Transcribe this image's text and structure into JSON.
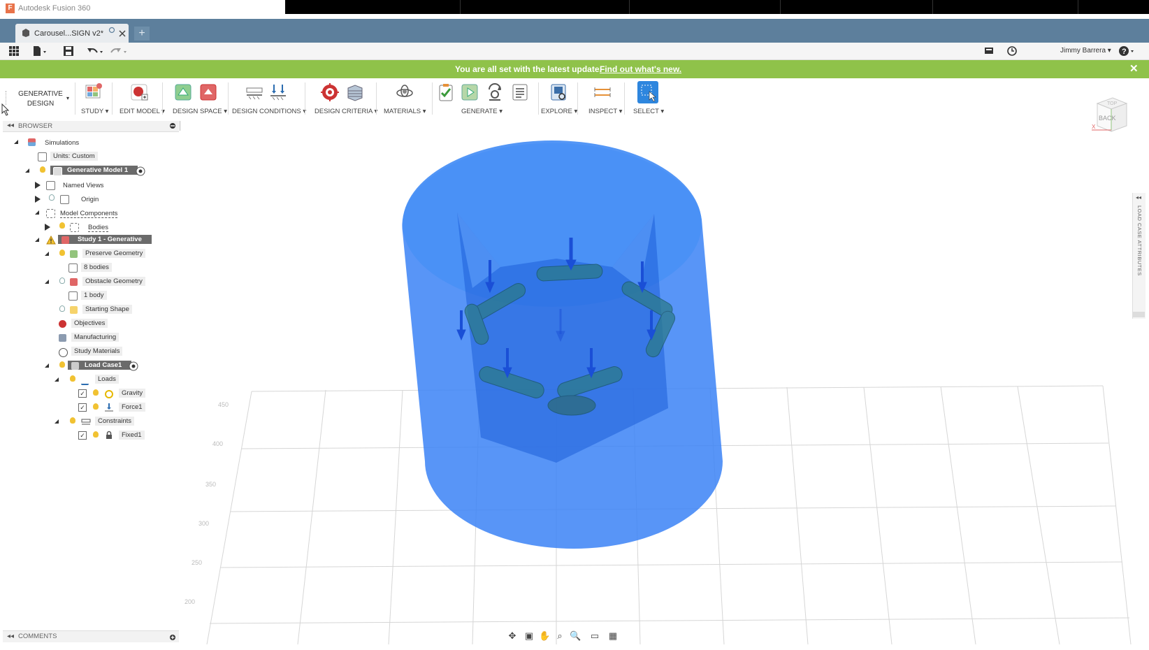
{
  "window": {
    "app_title": "Autodesk Fusion 360",
    "logo_glyph": "F"
  },
  "tabs": [
    {
      "label": "Carousel...SIGN v2*"
    }
  ],
  "quick_access": {
    "new_tab": "+",
    "user_name": "Jimmy Barrera ▾"
  },
  "banner": {
    "text": "You are all set with the latest update.",
    "link": "Find out what's new.",
    "close": "✕"
  },
  "toolbar": {
    "workspace": {
      "line1": "GENERATIVE",
      "line2": "DESIGN"
    },
    "groups": [
      {
        "label": "STUDY ▾"
      },
      {
        "label": "EDIT MODEL ▾"
      },
      {
        "label": "DESIGN SPACE ▾"
      },
      {
        "label": "DESIGN CONDITIONS ▾"
      },
      {
        "label": "DESIGN CRITERIA ▾"
      },
      {
        "label": "MATERIALS ▾"
      },
      {
        "label": "GENERATE ▾"
      },
      {
        "label": "EXPLORE ▾"
      },
      {
        "label": "INSPECT ▾"
      },
      {
        "label": "SELECT ▾"
      }
    ]
  },
  "browser": {
    "title": "BROWSER",
    "items": {
      "simulations": "Simulations",
      "units": "Units: Custom",
      "generative_model": "Generative Model 1",
      "named_views": "Named Views",
      "origin": "Origin",
      "model_components": "Model Components",
      "bodies": "Bodies",
      "study": "Study 1 - Generative",
      "preserve_geometry": "Preserve Geometry",
      "preserve_bodies": "8 bodies",
      "obstacle_geometry": "Obstacle Geometry",
      "obstacle_body": "1 body",
      "starting_shape": "Starting Shape",
      "objectives": "Objectives",
      "manufacturing": "Manufacturing",
      "study_materials": "Study Materials",
      "load_case": "Load Case1",
      "loads": "Loads",
      "gravity": "Gravity",
      "force1": "Force1",
      "constraints": "Constraints",
      "fixed1": "Fixed1"
    }
  },
  "comments": {
    "title": "COMMENTS"
  },
  "viewcube": {
    "face": "BACK",
    "top": "TOP",
    "axis": "X"
  },
  "right_panel": {
    "label": "LOAD CASE ATTRIBUTES"
  },
  "colors": {
    "accent_bar": "#5d7f9c",
    "banner": "#8fc24a",
    "design_space": "#3b82f6",
    "highlight": "#6b6b6b"
  }
}
